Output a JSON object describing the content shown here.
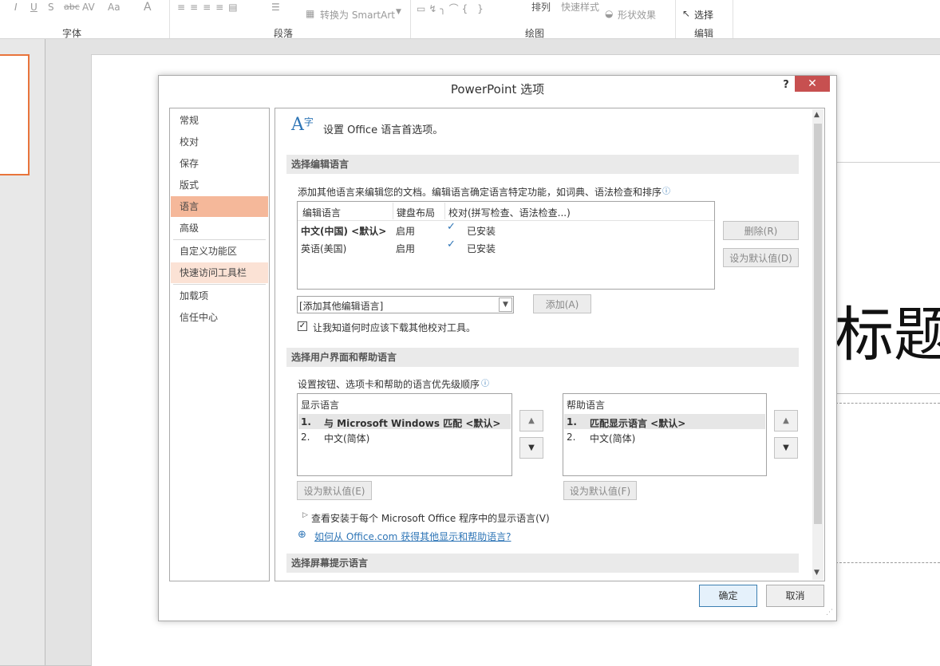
{
  "ribbon": {
    "fmt_glyphs": [
      "I",
      "U",
      "S",
      "abc",
      "AV",
      "Aa",
      "A"
    ],
    "convert_smartart": "转换为 SmartArt",
    "arrange": "排列",
    "quick_styles": "快速样式",
    "shape_effects": "形状效果",
    "select": "选择",
    "groups": {
      "font": "字体",
      "paragraph": "段落",
      "drawing": "绘图",
      "editing": "编辑"
    }
  },
  "slide": {
    "title_partial": "标题"
  },
  "dialog": {
    "title": "PowerPoint 选项",
    "help": "?",
    "close": "✕",
    "nav": [
      {
        "label": "常规"
      },
      {
        "label": "校对"
      },
      {
        "label": "保存"
      },
      {
        "label": "版式"
      },
      {
        "label": "语言"
      },
      {
        "label": "高级"
      },
      {
        "label": "自定义功能区"
      },
      {
        "label": "快速访问工具栏"
      },
      {
        "label": "加载项"
      },
      {
        "label": "信任中心"
      }
    ],
    "selected_nav": "语言",
    "header_text": "设置 Office 语言首选项。",
    "editing": {
      "section_title": "选择编辑语言",
      "description": "添加其他语言来编辑您的文档。编辑语言确定语言特定功能，如词典、语法检查和排序",
      "columns": [
        "编辑语言",
        "键盘布局",
        "校对(拼写检查、语法检查...)"
      ],
      "rows": [
        {
          "language": "中文(中国) <默认>",
          "keyboard": "启用",
          "proofing": "已安装"
        },
        {
          "language": "英语(美国)",
          "keyboard": "启用",
          "proofing": "已安装"
        }
      ],
      "delete_button": "删除(R)",
      "set_default_button": "设为默认值(D)",
      "add_select_value": "[添加其他编辑语言]",
      "add_button": "添加(A)",
      "notify_checkbox_label": "让我知道何时应该下载其他校对工具。",
      "notify_checked": true
    },
    "ui_lang": {
      "section_title": "选择用户界面和帮助语言",
      "description": "设置按钮、选项卡和帮助的语言优先级顺序",
      "display": {
        "header": "显示语言",
        "items": [
          {
            "num": "1.",
            "label": "与 Microsoft Windows 匹配 <默认>"
          },
          {
            "num": "2.",
            "label": "中文(简体)"
          }
        ],
        "set_default": "设为默认值(E)"
      },
      "help": {
        "header": "帮助语言",
        "items": [
          {
            "num": "1.",
            "label": "匹配显示语言 <默认>"
          },
          {
            "num": "2.",
            "label": "中文(简体)"
          }
        ],
        "set_default": "设为默认值(F)"
      },
      "view_installed": "查看安装于每个 Microsoft Office 程序中的显示语言(V)",
      "link": "如何从 Office.com 获得其他显示和帮助语言?"
    },
    "screentip_section_title": "选择屏幕提示语言",
    "ok": "确定",
    "cancel": "取消"
  }
}
